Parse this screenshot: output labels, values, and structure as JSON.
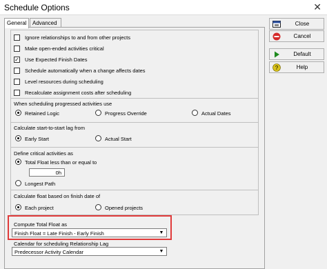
{
  "window": {
    "title": "Schedule Options",
    "close_glyph": "✕"
  },
  "tabs": [
    "General",
    "Advanced"
  ],
  "checkboxes": [
    {
      "label": "Ignore relationships to and from other projects",
      "checked": false
    },
    {
      "label": "Make open-ended activities critical",
      "checked": false
    },
    {
      "label": "Use Expected Finish Dates",
      "checked": true
    },
    {
      "label": "Schedule automatically when a change affects dates",
      "checked": false
    },
    {
      "label": "Level resources during scheduling",
      "checked": false
    },
    {
      "label": "Recalculate assignment costs after scheduling",
      "checked": false
    }
  ],
  "progressed": {
    "label": "When scheduling progressed activities use",
    "options": [
      "Retained Logic",
      "Progress Override",
      "Actual Dates"
    ],
    "selected": 0
  },
  "start_lag": {
    "label": "Calculate start-to-start lag from",
    "options": [
      "Early Start",
      "Actual Start"
    ],
    "selected": 0
  },
  "critical": {
    "label": "Define critical activities as",
    "options": [
      "Total Float less than or equal to",
      "Longest Path"
    ],
    "selected": 0,
    "float_value": "0h"
  },
  "float_basis": {
    "label": "Calculate float based on finish date of",
    "options": [
      "Each project",
      "Opened projects"
    ],
    "selected": 0
  },
  "total_float": {
    "label": "Compute Total Float as",
    "value": "Finish Float = Late Finish - Early Finish"
  },
  "calendar": {
    "label": "Calendar for scheduling Relationship Lag",
    "value": "Predecessor Activity Calendar"
  },
  "buttons": [
    {
      "label": "Close",
      "icon": "close-window-icon"
    },
    {
      "label": "Cancel",
      "icon": "cancel-icon"
    },
    {
      "label": "Default",
      "icon": "play-arrow-icon"
    },
    {
      "label": "Help",
      "icon": "help-icon"
    }
  ],
  "colors": {
    "highlight": "#e03a3a",
    "default_icon": "#1e8a1e",
    "cancel_icon": "#d52b2b",
    "help_icon": "#d9c21a"
  }
}
